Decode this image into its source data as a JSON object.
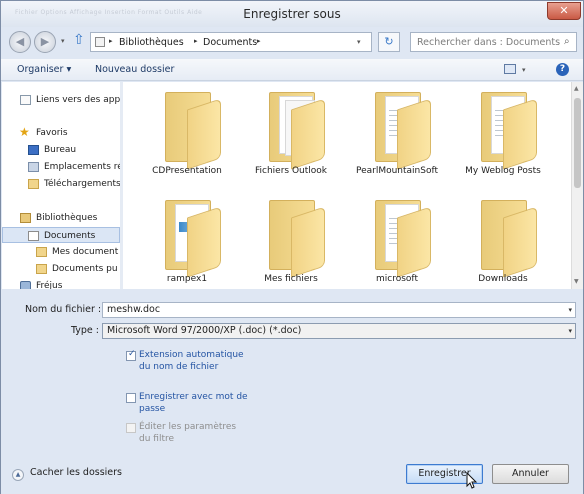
{
  "window": {
    "title": "Enregistrer sous",
    "ghost_menu": "Fichier   Options   Affichage   Insertion   Format   Outils   Aide",
    "close_symbol": "✕"
  },
  "navigation": {
    "back_symbol": "◀",
    "forward_symbol": "▶",
    "up_symbol": "⇧",
    "breadcrumb": [
      "Bibliothèques",
      "Documents"
    ],
    "refresh_symbol": "↻",
    "search_placeholder": "Rechercher dans : Documents"
  },
  "toolbar": {
    "organize_label": "Organiser ▾",
    "new_folder_label": "Nouveau dossier",
    "help_symbol": "?"
  },
  "nav_pane": {
    "items": [
      {
        "label": "Liens vers des appl",
        "icon": "page-icon"
      },
      {
        "label": "Favoris",
        "icon": "star-icon"
      },
      {
        "label": "Bureau",
        "icon": "desktop-icon"
      },
      {
        "label": "Emplacements ré",
        "icon": "location-icon"
      },
      {
        "label": "Téléchargements",
        "icon": "folder-icon"
      },
      {
        "label": "Bibliothèques",
        "icon": "library-icon"
      },
      {
        "label": "Documents",
        "icon": "documents-icon",
        "selected": true
      },
      {
        "label": "Mes document",
        "icon": "folder-icon"
      },
      {
        "label": "Documents pu",
        "icon": "folder-icon"
      },
      {
        "label": "Fréjus",
        "icon": "network-icon"
      }
    ]
  },
  "folders": [
    {
      "name": "CDPresentation",
      "style": "plain"
    },
    {
      "name": "Fichiers Outlook",
      "style": "papers"
    },
    {
      "name": "PearlMountainSoft",
      "style": "lines"
    },
    {
      "name": "My Weblog Posts",
      "style": "lines"
    },
    {
      "name": "rampex1",
      "style": "blue"
    },
    {
      "name": "Mes fichiers",
      "style": "plain"
    },
    {
      "name": "microsoft",
      "style": "lines"
    },
    {
      "name": "Downloads",
      "style": "plain"
    }
  ],
  "form": {
    "filename_label": "Nom du fichier :",
    "filename_value": "meshw.doc",
    "type_label": "Type :",
    "type_value": "Microsoft Word 97/2000/XP (.doc) (*.doc)",
    "options": [
      {
        "label": "Extension automatique du nom de fichier",
        "checked": true,
        "enabled": true
      },
      {
        "label": "Enregistrer avec mot de passe",
        "checked": false,
        "enabled": true
      },
      {
        "label": "Éditer les paramètres du filtre",
        "checked": false,
        "enabled": false
      }
    ]
  },
  "footer": {
    "hide_folders_label": "Cacher les dossiers",
    "save_label": "Enregistrer",
    "cancel_label": "Annuler"
  }
}
